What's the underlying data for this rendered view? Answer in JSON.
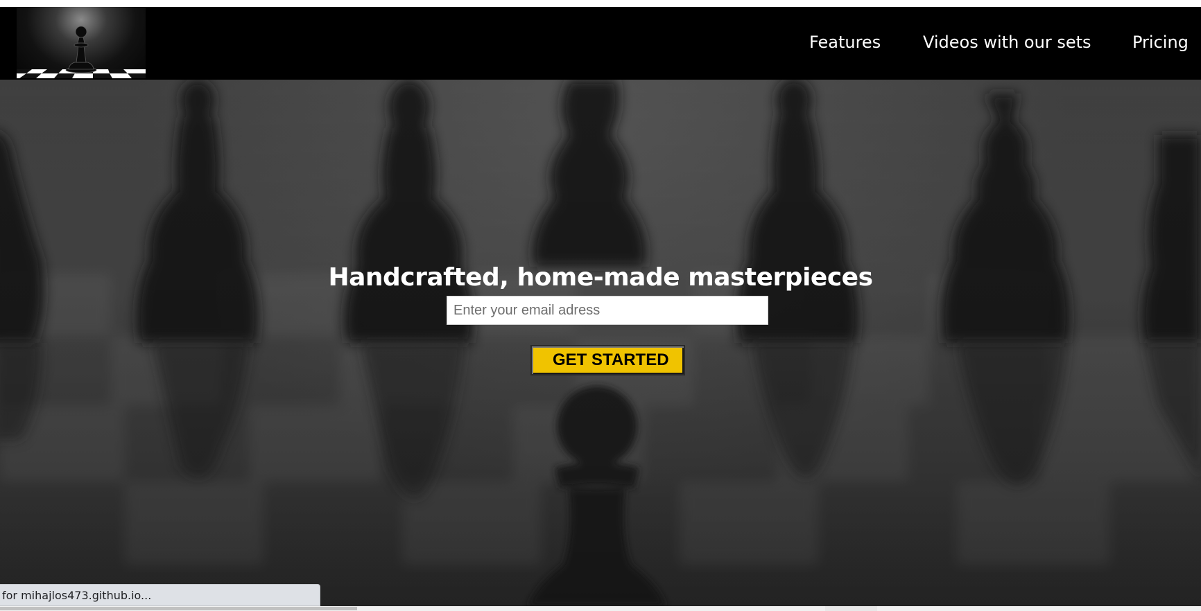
{
  "header": {
    "logo_name": "pawn-logo",
    "nav": [
      {
        "label": "Features"
      },
      {
        "label": "Videos with our sets"
      },
      {
        "label": "Pricing"
      }
    ]
  },
  "hero": {
    "title": "Handcrafted, home-made masterpieces",
    "email_placeholder": "Enter your email adress",
    "email_value": "",
    "cta_label": "GET STARTED",
    "cta_color": "#f0c300",
    "background": "blurred-chess-pieces-grayscale"
  },
  "status_bar": {
    "text": "for mihajlos473.github.io..."
  }
}
